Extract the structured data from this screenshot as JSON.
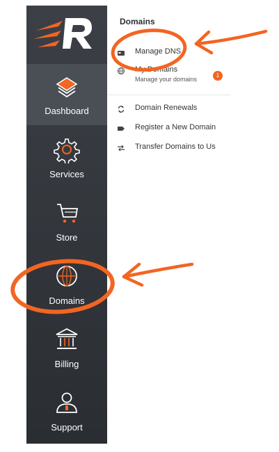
{
  "sidebar": {
    "items": [
      {
        "label": "Dashboard",
        "icon": "layers-icon"
      },
      {
        "label": "Services",
        "icon": "gear-icon"
      },
      {
        "label": "Store",
        "icon": "cart-icon"
      },
      {
        "label": "Domains",
        "icon": "globe-icon"
      },
      {
        "label": "Billing",
        "icon": "bank-icon"
      },
      {
        "label": "Support",
        "icon": "person-icon"
      }
    ]
  },
  "panel": {
    "title": "Domains",
    "items": [
      {
        "label": "Manage DNS",
        "icon": "dns-card-icon"
      },
      {
        "label": "My Domains",
        "subtitle": "Manage your domains",
        "icon": "globe-small-icon",
        "badge": "1"
      },
      {
        "label": "Domain Renewals",
        "icon": "refresh-icon"
      },
      {
        "label": "Register a New Domain",
        "icon": "tag-icon"
      },
      {
        "label": "Transfer Domains to Us",
        "icon": "transfer-arrows-icon"
      }
    ]
  },
  "colors": {
    "accent": "#f26522",
    "sidebar": "#33363c",
    "active": "#4a4e55"
  }
}
